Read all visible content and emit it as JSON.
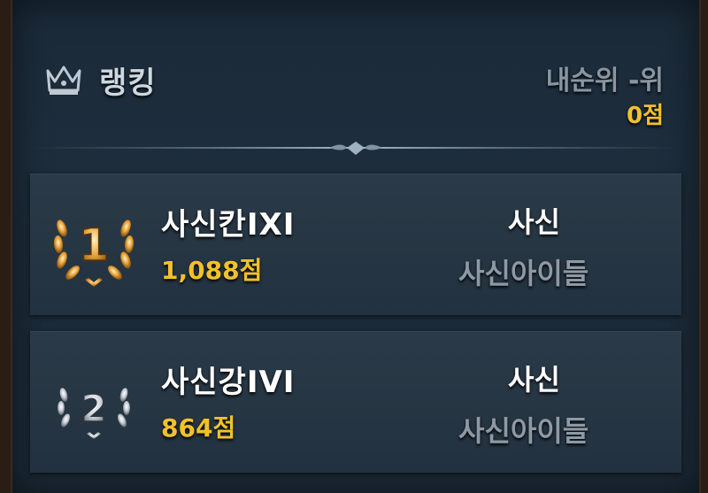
{
  "header": {
    "title": "랭킹",
    "my_rank": "내순위 -위",
    "my_score": "0점",
    "icon": "crown-icon"
  },
  "rankings": [
    {
      "rank": "1",
      "name": "사신칸IXI",
      "score": "1,088점",
      "class": "사신",
      "guild": "사신아이들",
      "badge_color": "#e8a43a"
    },
    {
      "rank": "2",
      "name": "사신강IVI",
      "score": "864점",
      "class": "사신",
      "guild": "사신아이들",
      "badge_color": "#c8ced6"
    }
  ],
  "colors": {
    "score": "#f2c12a",
    "panel": "#1d2d3c"
  }
}
